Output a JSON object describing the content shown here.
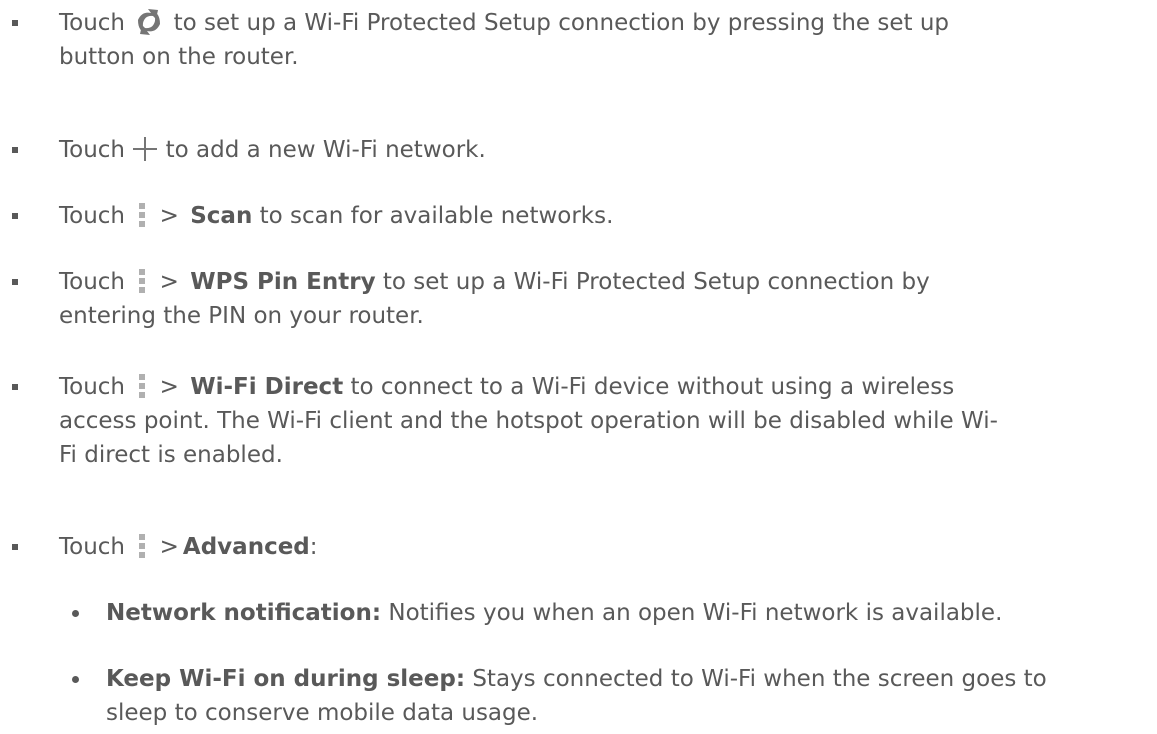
{
  "bullets": [
    {
      "pre": "Touch",
      "icon": "wps-icon",
      "post": "to set up a Wi-Fi Protected Setup connection by pressing the set up",
      "line2": "button on the router."
    },
    {
      "pre": "Touch",
      "icon": "plus-icon",
      "post": "to add a new Wi-Fi network."
    },
    {
      "pre": "Touch",
      "icon": "menu-dots-icon",
      "sep": ">",
      "bold": "Scan",
      "post": "to scan for available networks."
    },
    {
      "pre": "Touch",
      "icon": "menu-dots-icon",
      "sep": ">",
      "bold": "WPS Pin Entry",
      "post": "to set up a Wi-Fi Protected Setup connection by",
      "line2": "entering the PIN on your router."
    },
    {
      "pre": "Touch",
      "icon": "menu-dots-icon",
      "sep": ">",
      "bold": "Wi-Fi Direct",
      "post": "to connect to a Wi-Fi device without using a wireless",
      "line2": "access point. The Wi-Fi client and the hotspot operation will be disabled while Wi-",
      "line3": "Fi direct is enabled."
    },
    {
      "pre": "Touch",
      "icon": "menu-dots-icon",
      "sep": ">",
      "bold": "Advanced",
      "post": ":"
    }
  ],
  "sub_bullets": [
    {
      "bold": "Network notification:",
      "text": "Notifies you when an open Wi-Fi network is available."
    },
    {
      "bold": "Keep Wi-Fi on during sleep:",
      "text": "Stays connected to Wi-Fi when the screen goes to",
      "line2": "sleep to conserve mobile data usage."
    }
  ],
  "colors": {
    "text": "#595959",
    "icon": "#757575",
    "dots": "#b0b0b0"
  }
}
